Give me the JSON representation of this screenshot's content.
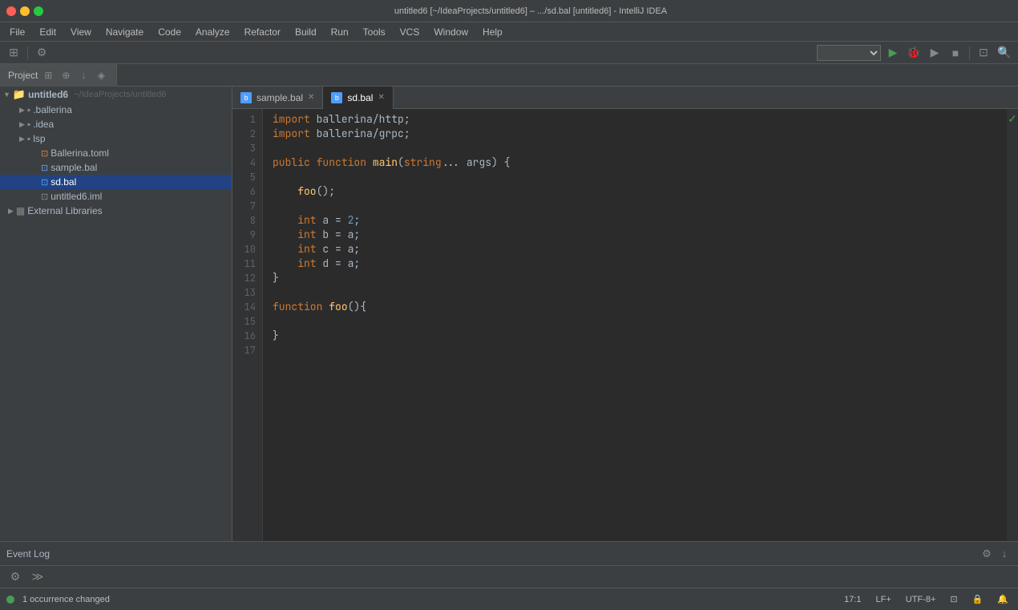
{
  "titleBar": {
    "title": "untitled6 [~/IdeaProjects/untitled6] – .../sd.bal [untitled6] - IntelliJ IDEA"
  },
  "menuBar": {
    "items": [
      "File",
      "Edit",
      "View",
      "Navigate",
      "Code",
      "Analyze",
      "Refactor",
      "Build",
      "Run",
      "Tools",
      "VCS",
      "Window",
      "Help"
    ]
  },
  "projectTab": {
    "label": "Project",
    "icons": [
      "⊞",
      "⊕",
      "↓",
      "◈"
    ]
  },
  "tabs": {
    "sampleBal": {
      "label": "sample.bal",
      "active": false,
      "icon": "b"
    },
    "sdBal": {
      "label": "sd.bal",
      "active": true,
      "icon": "b"
    }
  },
  "projectTree": {
    "root": {
      "label": "untitled6",
      "path": "~/IdeaProjects/untitled6",
      "expanded": true,
      "children": [
        {
          "label": ".ballerina",
          "type": "folder",
          "expanded": false,
          "indent": 2
        },
        {
          "label": ".idea",
          "type": "folder",
          "expanded": false,
          "indent": 2
        },
        {
          "label": "lsp",
          "type": "folder",
          "expanded": false,
          "indent": 2
        },
        {
          "label": "Ballerina.toml",
          "type": "file-toml",
          "indent": 3
        },
        {
          "label": "sample.bal",
          "type": "file-bal",
          "indent": 3
        },
        {
          "label": "sd.bal",
          "type": "file-bal",
          "indent": 3
        },
        {
          "label": "untitled6.iml",
          "type": "file-iml",
          "indent": 3
        }
      ]
    },
    "externalLibraries": {
      "label": "External Libraries",
      "indent": 1
    }
  },
  "codeLines": [
    {
      "num": 1,
      "html": "<span class='kw'>import</span> ballerina/http;"
    },
    {
      "num": 2,
      "html": "<span class='kw'>import</span> ballerina/grpc;"
    },
    {
      "num": 3,
      "html": ""
    },
    {
      "num": 4,
      "html": "<span class='kw'>public</span> <span class='kw'>function</span> <span class='fn-name'>main</span>(<span class='kw-type'>string</span>... args) {"
    },
    {
      "num": 5,
      "html": ""
    },
    {
      "num": 6,
      "html": "    <span class='fn-name'>foo</span>();"
    },
    {
      "num": 7,
      "html": ""
    },
    {
      "num": 8,
      "html": "    <span class='kw-type'>int</span> a = <span class='num'>2</span>;"
    },
    {
      "num": 9,
      "html": "    <span class='kw-type'>int</span> b = a;"
    },
    {
      "num": 10,
      "html": "    <span class='kw-type'>int</span> c = a;"
    },
    {
      "num": 11,
      "html": "    <span class='kw-type'>int</span> d = a;"
    },
    {
      "num": 12,
      "html": "}"
    },
    {
      "num": 13,
      "html": ""
    },
    {
      "num": 14,
      "html": "<span class='kw'>function</span> <span class='fn-name'>foo</span>(){"
    },
    {
      "num": 15,
      "html": ""
    },
    {
      "num": 16,
      "html": "}"
    },
    {
      "num": 17,
      "html": ""
    }
  ],
  "toolbar": {
    "dropdownValue": "",
    "dropdownPlaceholder": ""
  },
  "eventLog": {
    "title": "Event Log",
    "settingsIcon": "⚙",
    "downloadIcon": "↓"
  },
  "statusBar": {
    "occurrences": "1 occurrence changed",
    "position": "17:1",
    "lineEnding": "LF+",
    "encoding": "UTF-8+",
    "indent": "⊡",
    "lock": "🔒",
    "notifications": "🔔"
  },
  "bottomLeftIcons": [
    "⚙",
    "≫"
  ],
  "sidebarBreadcrumbs": {
    "projectName": "untitled6",
    "projectPath": "~/IdeaProjects/untitled6"
  }
}
